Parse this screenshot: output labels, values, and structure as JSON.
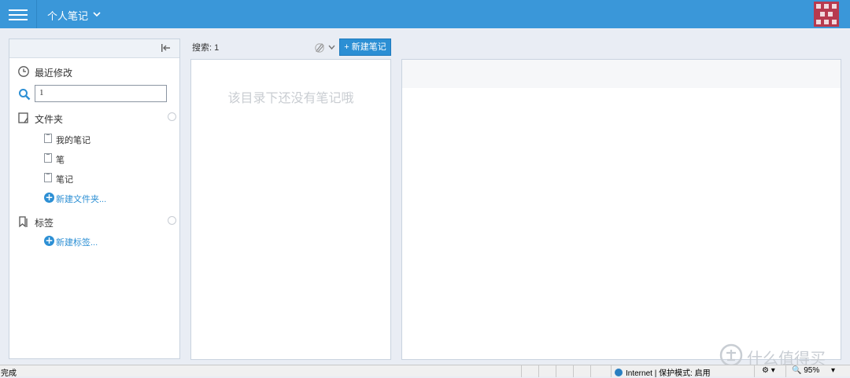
{
  "app": {
    "notebook_title": "个人笔记"
  },
  "sidebar": {
    "recent_label": "最近修改",
    "search_value": "1",
    "folders_label": "文件夹",
    "folders": [
      {
        "label": "我的笔记"
      },
      {
        "label": "笔"
      },
      {
        "label": "笔记"
      }
    ],
    "new_folder_label": "新建文件夹...",
    "tags_label": "标签",
    "new_tag_label": "新建标签..."
  },
  "list": {
    "search_label": "搜索: 1",
    "new_note_label": "+ 新建笔记",
    "empty_message": "该目录下还没有笔记哦"
  },
  "watermark": {
    "text": "什么值得买"
  },
  "statusbar": {
    "status": "完成",
    "zone": "Internet | 保护模式: 启用",
    "zoom": "95%"
  },
  "colors": {
    "topbar": "#3a97d9",
    "accent": "#2c8fd4"
  }
}
